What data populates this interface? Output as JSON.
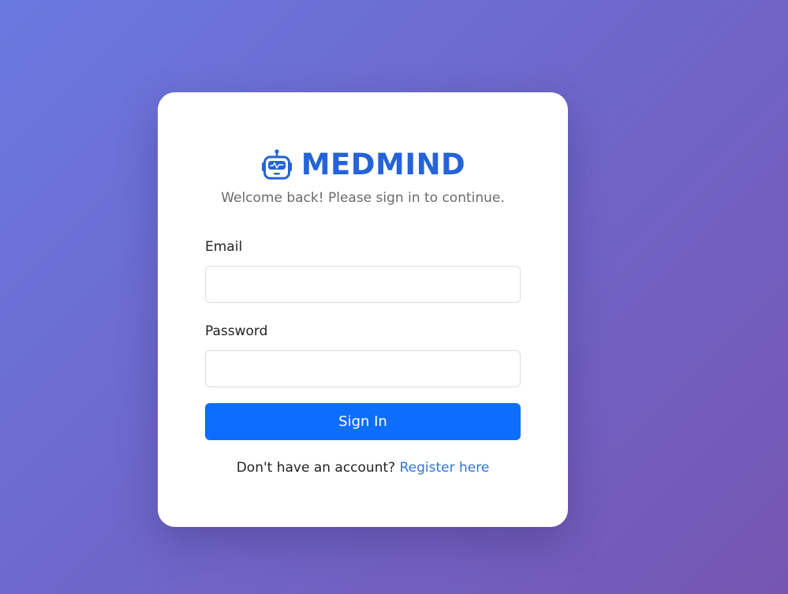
{
  "brand": {
    "title": "MEDMIND",
    "icon": "robot-icon",
    "color": "#2563d8"
  },
  "subtitle": "Welcome back! Please sign in to continue.",
  "form": {
    "email_label": "Email",
    "email_value": "",
    "password_label": "Password",
    "password_value": "",
    "submit_label": "Sign In"
  },
  "register": {
    "prompt": "Don't have an account?",
    "link_label": "Register here"
  },
  "colors": {
    "accent": "#0d6efd",
    "link": "#2f76d2",
    "background_start": "#6a79e0",
    "background_end": "#7656b2"
  }
}
